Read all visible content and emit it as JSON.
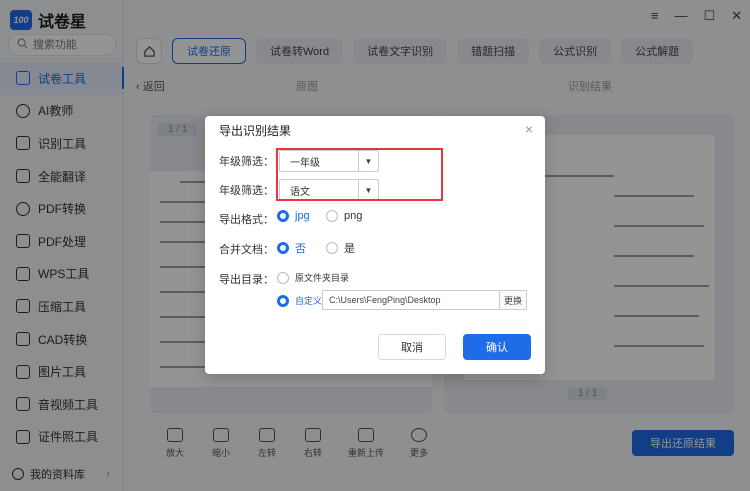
{
  "app": {
    "title": "试卷星",
    "logo_badge": "100"
  },
  "search": {
    "placeholder": "搜索功能"
  },
  "sidebar": {
    "items": [
      {
        "label": "试卷工具",
        "icon": "layers-icon"
      },
      {
        "label": "AI教师",
        "icon": "user-icon"
      },
      {
        "label": "识别工具",
        "icon": "scan-icon"
      },
      {
        "label": "全能翻译",
        "icon": "translate-icon"
      },
      {
        "label": "PDF转换",
        "icon": "refresh-icon"
      },
      {
        "label": "PDF处理",
        "icon": "pdf-icon"
      },
      {
        "label": "WPS工具",
        "icon": "wps-icon"
      },
      {
        "label": "压缩工具",
        "icon": "compress-icon"
      },
      {
        "label": "CAD转换",
        "icon": "cad-icon"
      },
      {
        "label": "图片工具",
        "icon": "image-icon"
      },
      {
        "label": "音视频工具",
        "icon": "media-icon"
      },
      {
        "label": "证件照工具",
        "icon": "id-photo-icon"
      }
    ],
    "library": "我的资料库"
  },
  "tabs": [
    "试卷还原",
    "试卷转Word",
    "试卷文字识别",
    "错题扫描",
    "公式识别",
    "公式解题"
  ],
  "subbar": {
    "back": "返回",
    "original": "原图",
    "result": "识别结果"
  },
  "pages": {
    "left": "1 / 1",
    "right": "1 / 1"
  },
  "bottom_tools": [
    "放大",
    "缩小",
    "左转",
    "右转",
    "重新上传",
    "更多"
  ],
  "export_button": "导出还原结果",
  "dialog": {
    "title": "导出识别结果",
    "grade_label": "年级筛选：",
    "grade_value": "一年级",
    "subject_label": "年级筛选：",
    "subject_value": "语文",
    "format_label": "导出格式：",
    "format_options": [
      "jpg",
      "png"
    ],
    "merge_label": "合并文档：",
    "merge_options": [
      "否",
      "是"
    ],
    "dir_label": "导出目录：",
    "dir_option_original": "原文件夹目录",
    "dir_option_custom": "自定义",
    "custom_path": "C:\\Users\\FengPing\\Desktop",
    "change_button": "更换",
    "cancel_button": "取消",
    "ok_button": "确认"
  }
}
